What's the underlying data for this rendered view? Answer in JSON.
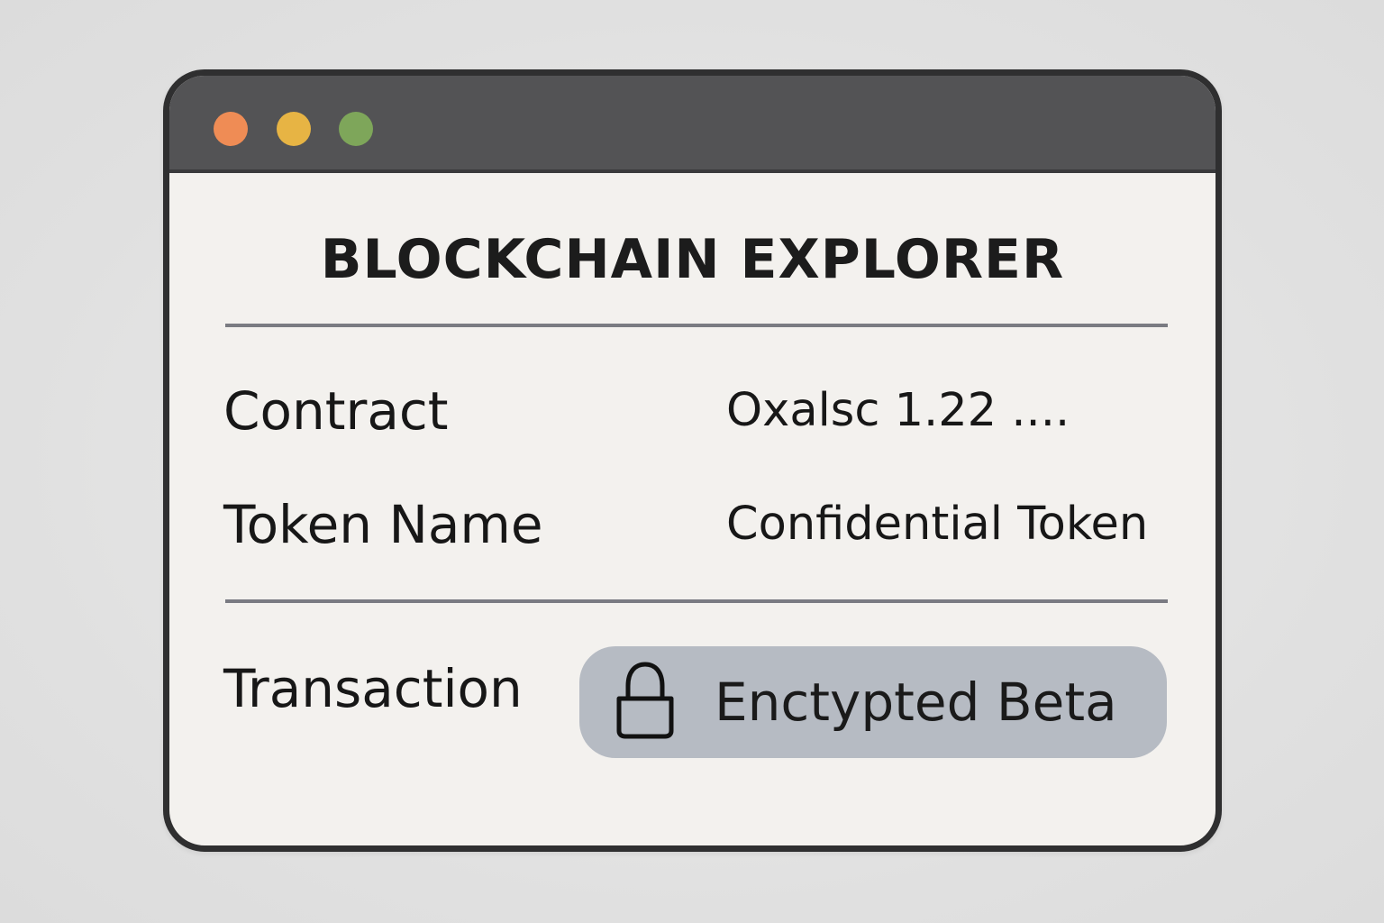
{
  "window": {
    "controls": [
      {
        "name": "close",
        "color": "#ef8c55"
      },
      {
        "name": "minimize",
        "color": "#e7b444"
      },
      {
        "name": "maximize",
        "color": "#7ea65a"
      }
    ]
  },
  "page": {
    "title": "BLOCKCHAIN EXPLORER"
  },
  "details": {
    "contract_label": "Contract",
    "contract_value": "Oxalsc 1.22 ....",
    "token_name_label": "Token Name",
    "token_name_value": "Confidential Token",
    "transaction_label": "Transaction"
  },
  "badge": {
    "icon": "lock-icon",
    "text": "Enctypted Beta",
    "background": "#b6bbc3"
  }
}
